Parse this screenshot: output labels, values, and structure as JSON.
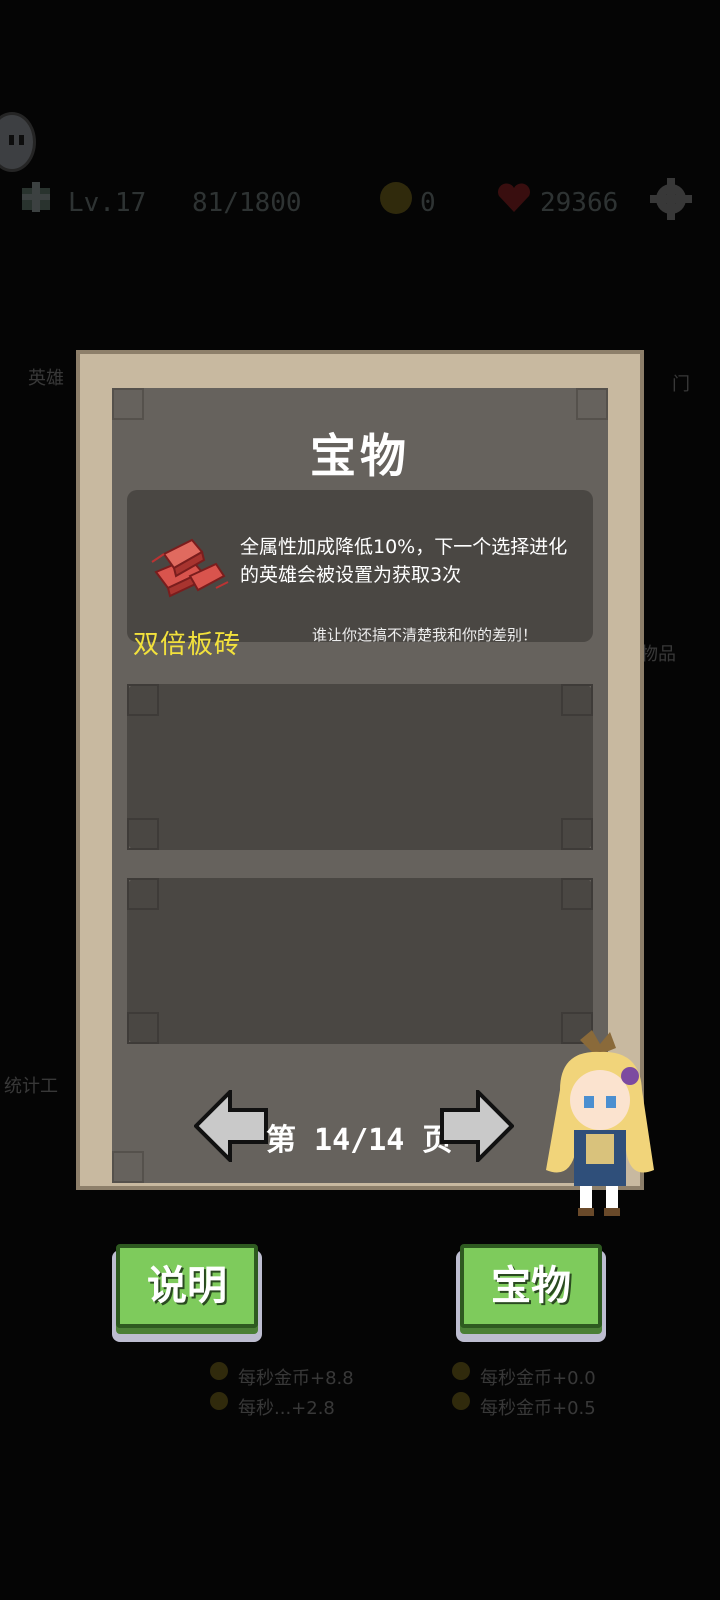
{
  "hud": {
    "level": "Lv.17",
    "exp": "81/1800",
    "coins": "0",
    "hp": "29366"
  },
  "background": {
    "left_labels": [
      "英雄",
      "统计工"
    ],
    "right_labels": [
      "门",
      "物品"
    ],
    "stats": [
      "每秒金币+8.8",
      "每秒...+2.8",
      "每秒金币+0.0",
      "每秒金币+0.5"
    ]
  },
  "panel": {
    "title": "宝物",
    "item": {
      "icon": "brick-icon",
      "name": "双倍板砖",
      "description": "全属性加成降低10%，下一个选择进化的英雄会被设置为获取3次",
      "quote": "谁让你还搞不清楚我和你的差别！"
    },
    "pager": {
      "text": "第 14/14 页"
    }
  },
  "buttons": {
    "explain": "说明",
    "treasure": "宝物"
  },
  "colors": {
    "panel_frame": "#c8b9a0",
    "panel_inner": "#66625d",
    "slot": "#4a4743",
    "item_name": "#f2e13c",
    "button_green": "#7ecb5c"
  }
}
